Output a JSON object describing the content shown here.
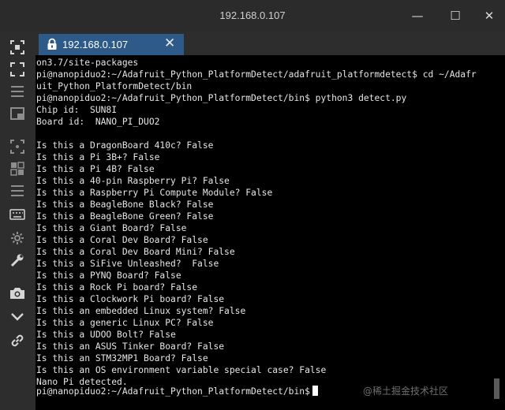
{
  "window": {
    "title": "192.168.0.107",
    "minimize_glyph": "—",
    "maximize_glyph": "☐",
    "close_glyph": "✕"
  },
  "sidebar": {
    "icons": [
      "screenshot-icon",
      "fullscreen-icon",
      "menu-icon",
      "split-view-icon",
      "select-icon",
      "grid-icon",
      "list-icon",
      "keyboard-icon",
      "settings-icon",
      "wrench-icon",
      "camera-icon",
      "chevron-down-icon",
      "link-icon"
    ]
  },
  "tab": {
    "label": "192.168.0.107",
    "close_glyph": "✕"
  },
  "terminal": {
    "lines": [
      "on3.7/site-packages",
      "pi@nanopiduo2:~/Adafruit_Python_PlatformDetect/adafruit_platformdetect$ cd ~/Adafr",
      "uit_Python_PlatformDetect/bin",
      "pi@nanopiduo2:~/Adafruit_Python_PlatformDetect/bin$ python3 detect.py",
      "Chip id:  SUN8I",
      "Board id:  NANO_PI_DUO2",
      "",
      "Is this a DragonBoard 410c? False",
      "Is this a Pi 3B+? False",
      "Is this a Pi 4B? False",
      "Is this a 40-pin Raspberry Pi? False",
      "Is this a Raspberry Pi Compute Module? False",
      "Is this a BeagleBone Black? False",
      "Is this a BeagleBone Green? False",
      "Is this a Giant Board? False",
      "Is this a Coral Dev Board? False",
      "Is this a Coral Dev Board Mini? False",
      "Is this a SiFive Unleashed?  False",
      "Is this a PYNQ Board? False",
      "Is this a Rock Pi board? False",
      "Is this a Clockwork Pi board? False",
      "Is this an embedded Linux system? False",
      "Is this a generic Linux PC? False",
      "Is this a UDOO Bolt? False",
      "Is this an ASUS Tinker Board? False",
      "Is this an STM32MP1 Board? False",
      "Is this an OS environment variable special case? False",
      "Nano Pi detected."
    ],
    "prompt": "pi@nanopiduo2:~/Adafruit_Python_PlatformDetect/bin$"
  },
  "watermark": "@稀土掘金技术社区",
  "colors": {
    "chrome_bg": "#2b2b2b",
    "tab_active": "#2d5a89",
    "terminal_bg": "#000000",
    "terminal_fg": "#e6e6e6"
  }
}
